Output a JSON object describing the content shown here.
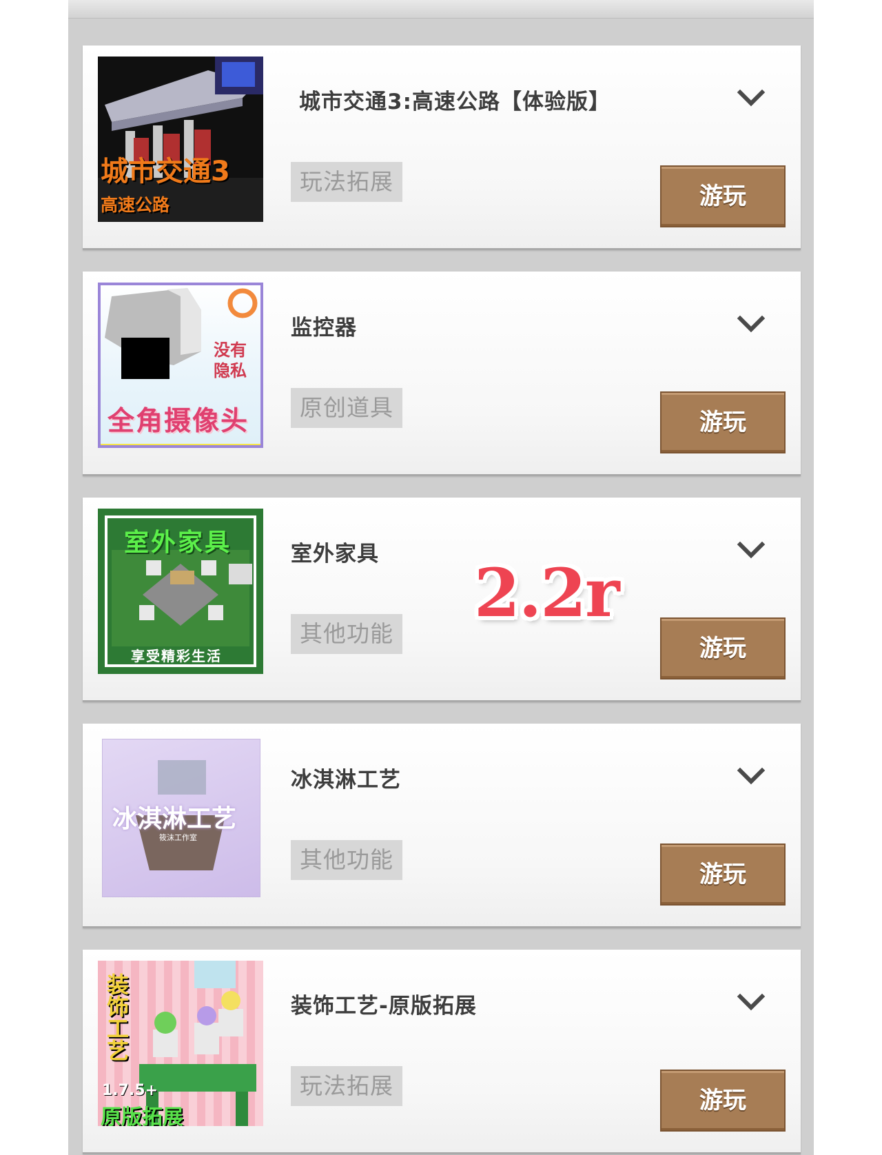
{
  "items": [
    {
      "title": "城市交通3:高速公路【体验版】",
      "tag": "玩法拓展",
      "play_label": "游玩",
      "thumb_texts": [
        "城市交通3",
        "高速公路"
      ]
    },
    {
      "title": "监控器",
      "tag": "原创道具",
      "play_label": "游玩",
      "thumb_texts": [
        "没有",
        "隐私",
        "全角摄像头"
      ]
    },
    {
      "title": "室外家具",
      "tag": "其他功能",
      "play_label": "游玩",
      "thumb_texts": [
        "室外家具",
        "享受精彩生活"
      ]
    },
    {
      "title": "冰淇淋工艺",
      "tag": "其他功能",
      "play_label": "游玩",
      "thumb_texts": [
        "冰淇淋工艺",
        "筱沫工作室"
      ]
    },
    {
      "title": "装饰工艺-原版拓展",
      "tag": "玩法拓展",
      "play_label": "游玩",
      "thumb_texts": [
        "装饰工艺",
        "1.7.5+",
        "原版拓展"
      ]
    }
  ],
  "overlay_stamp": "2.2r",
  "colors": {
    "play_button": "#a77d55",
    "tag_bg": "#d7d7d7",
    "panel_bg": "#cfcfcf",
    "stamp": "#ee4452"
  }
}
